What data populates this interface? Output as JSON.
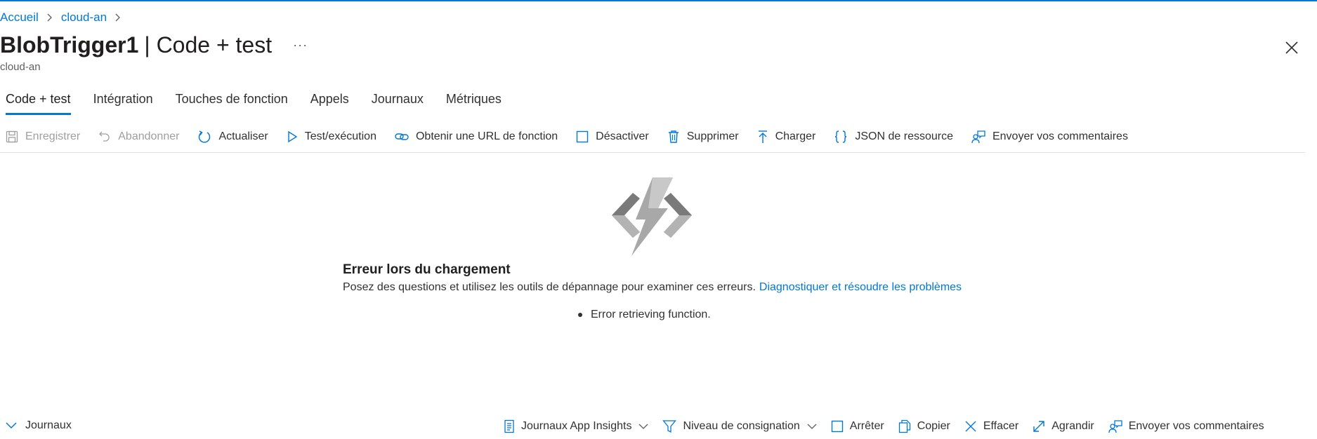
{
  "breadcrumb": {
    "home": "Accueil",
    "parent": "cloud-an"
  },
  "header": {
    "title_bold": "BlobTrigger1",
    "title_rest": "| Code + test",
    "subtitle": "cloud-an",
    "more": "···"
  },
  "tabs": [
    {
      "label": "Code + test",
      "active": true
    },
    {
      "label": "Intégration"
    },
    {
      "label": "Touches de fonction"
    },
    {
      "label": "Appels"
    },
    {
      "label": "Journaux"
    },
    {
      "label": "Métriques"
    }
  ],
  "toolbar": {
    "save": "Enregistrer",
    "discard": "Abandonner",
    "refresh": "Actualiser",
    "test": "Test/exécution",
    "get_url": "Obtenir une URL de fonction",
    "disable": "Désactiver",
    "delete": "Supprimer",
    "upload": "Charger",
    "json": "JSON de ressource",
    "feedback": "Envoyer vos commentaires"
  },
  "error": {
    "title": "Erreur lors du chargement",
    "description": "Posez des questions et utilisez les outils de dépannage pour examiner ces erreurs.",
    "link": "Diagnostiquer et résoudre les problèmes",
    "items": [
      "Error retrieving function."
    ]
  },
  "bottom_bar": {
    "logs": "Journaux",
    "app_insights": "Journaux App Insights",
    "log_level": "Niveau de consignation",
    "stop": "Arrêter",
    "copy": "Copier",
    "clear": "Effacer",
    "expand": "Agrandir",
    "feedback": "Envoyer vos commentaires"
  },
  "colors": {
    "accent": "#0078d4",
    "text": "#323130",
    "disabled": "#a19f9d",
    "divider": "#e1dfdd"
  }
}
